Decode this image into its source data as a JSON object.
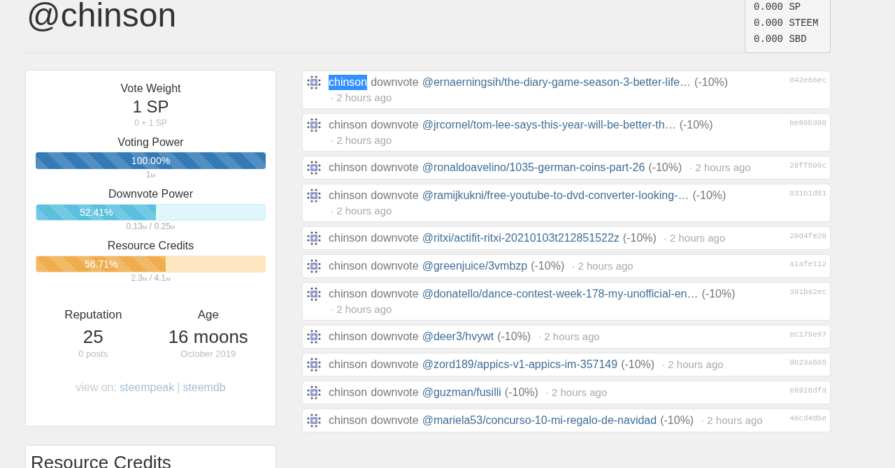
{
  "account": {
    "title": "@chinson"
  },
  "balances": [
    "0.000 SP",
    "0.000 STEEM",
    "0.000 SBD"
  ],
  "vote_weight": {
    "label": "Vote Weight",
    "value": "1 SP",
    "detail": "0 + 1 SP"
  },
  "meters": [
    {
      "label": "Voting Power",
      "kind": "primary",
      "level": 1.0,
      "reading": "100.00%",
      "detail": "1$_{M}$"
    },
    {
      "label": "Downvote Power",
      "kind": "info",
      "level": 0.5241,
      "reading": "52.41%",
      "detail": "0.13$_{M}$ / 0.25$_{M}$"
    },
    {
      "label": "Resource Credits",
      "kind": "warning",
      "level": 0.5671,
      "reading": "56.71%",
      "detail": "2.3$_{M}$ / 4.1$_{M}$"
    }
  ],
  "stats": [
    {
      "label": "Reputation",
      "value": "25",
      "detail": "0 posts"
    },
    {
      "label": "Age",
      "value": "16 moons",
      "detail": "October 2019"
    }
  ],
  "view_on": {
    "label": "view on:",
    "links": [
      "steempeak",
      "steemdb"
    ],
    "separator": "|"
  },
  "second_card": {
    "title": "Resource Credits"
  },
  "activity": [
    {
      "actor": "chinson",
      "actor_selected": true,
      "action": "downvote",
      "target": "@ernaerningsih/the-diary-game-season-3-better-life…",
      "weight": "(-10%)",
      "time": "· 2 hours ago",
      "hash": "042e66ec"
    },
    {
      "actor": "chinson",
      "actor_selected": false,
      "action": "downvote",
      "target": "@jrcornel/tom-lee-says-this-year-will-be-better-th…",
      "weight": "(-10%)",
      "time": "· 2 hours ago",
      "hash": "be86b398"
    },
    {
      "actor": "chinson",
      "actor_selected": false,
      "action": "downvote",
      "target": "@ronaldoavelino/1035-german-coins-part-26",
      "weight": "(-10%)",
      "time": "· 2 hours ago",
      "hash": "28ff509c"
    },
    {
      "actor": "chinson",
      "actor_selected": false,
      "action": "downvote",
      "target": "@ramijkukni/free-youtube-to-dvd-converter-looking-…",
      "weight": "(-10%)",
      "time": "· 2 hours ago",
      "hash": "031b1d51"
    },
    {
      "actor": "chinson",
      "actor_selected": false,
      "action": "downvote",
      "target": "@ritxi/actifit-ritxi-20210103t212851522z",
      "weight": "(-10%)",
      "time": "· 2 hours ago",
      "hash": "29d4fe20"
    },
    {
      "actor": "chinson",
      "actor_selected": false,
      "action": "downvote",
      "target": "@greenjuice/3vmbzp",
      "weight": "(-10%)",
      "time": "· 2 hours ago",
      "hash": "a1afe112"
    },
    {
      "actor": "chinson",
      "actor_selected": false,
      "action": "downvote",
      "target": "@donatello/dance-contest-week-178-my-unofficial-en…",
      "weight": "(-10%)",
      "time": "· 2 hours ago",
      "hash": "391ba2ec"
    },
    {
      "actor": "chinson",
      "actor_selected": false,
      "action": "downvote",
      "target": "@deer3/hvywt",
      "weight": "(-10%)",
      "time": "· 2 hours ago",
      "hash": "ec179e97"
    },
    {
      "actor": "chinson",
      "actor_selected": false,
      "action": "downvote",
      "target": "@zord189/appics-v1-appics-im-357149",
      "weight": "(-10%)",
      "time": "· 2 hours ago",
      "hash": "9b23a665"
    },
    {
      "actor": "chinson",
      "actor_selected": false,
      "action": "downvote",
      "target": "@guzman/fusilli",
      "weight": "(-10%)",
      "time": "· 2 hours ago",
      "hash": "e8916dfa"
    },
    {
      "actor": "chinson",
      "actor_selected": false,
      "action": "downvote",
      "target": "@mariela53/concurso-10-mi-regalo-de-navidad",
      "weight": "(-10%)",
      "time": "· 2 hours ago",
      "hash": "40cd4d5e"
    }
  ]
}
